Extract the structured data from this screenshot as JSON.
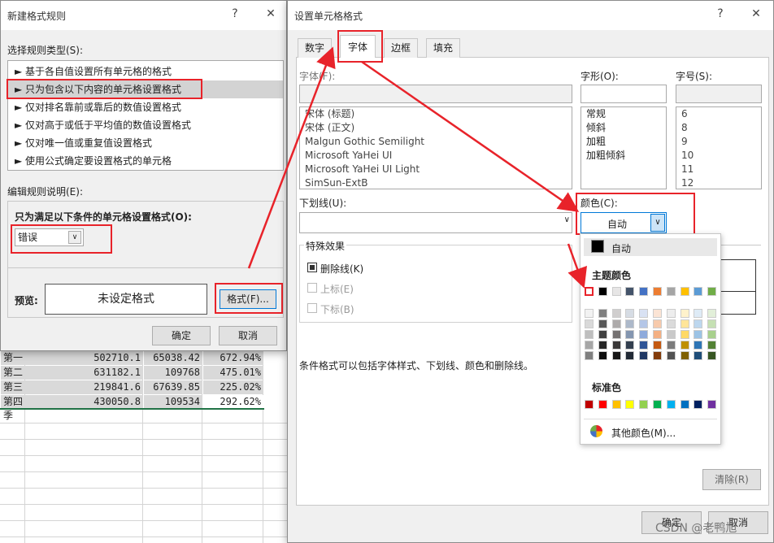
{
  "sheet": {
    "rows": [
      {
        "label": "第一季",
        "v1": "502710.1",
        "v2": "65038.42",
        "v3": "672.94%"
      },
      {
        "label": "第二季",
        "v1": "631182.1",
        "v2": "109768",
        "v3": "475.01%"
      },
      {
        "label": "第三季",
        "v1": "219841.6",
        "v2": "67639.85",
        "v3": "225.02%"
      },
      {
        "label": "第四季",
        "v1": "430050.8",
        "v2": "109534",
        "v3": "292.62%"
      }
    ]
  },
  "rule": {
    "title": "新建格式规则",
    "help": "?",
    "close": "✕",
    "type_label": "选择规则类型(S):",
    "types": [
      "► 基于各自值设置所有单元格的格式",
      "► 只为包含以下内容的单元格设置格式",
      "► 仅对排名靠前或靠后的数值设置格式",
      "► 仅对高于或低于平均值的数值设置格式",
      "► 仅对唯一值或重复值设置格式",
      "► 使用公式确定要设置格式的单元格"
    ],
    "edit_label": "编辑规则说明(E):",
    "cond_label": "只为满足以下条件的单元格设置格式(O):",
    "cond_value": "错误",
    "preview_label": "预览:",
    "preview_text": "未设定格式",
    "format_btn": "格式(F)...",
    "ok": "确定",
    "cancel": "取消"
  },
  "fmt": {
    "title": "设置单元格格式",
    "help": "?",
    "close": "✕",
    "tabs": [
      "数字",
      "字体",
      "边框",
      "填充"
    ],
    "font_label": "字体(F):",
    "fonts": [
      "宋体 (标题)",
      "宋体 (正文)",
      "Malgun Gothic Semilight",
      "Microsoft YaHei UI",
      "Microsoft YaHei UI Light",
      "SimSun-ExtB"
    ],
    "style_label": "字形(O):",
    "styles": [
      "常规",
      "倾斜",
      "加粗",
      "加粗倾斜"
    ],
    "size_label": "字号(S):",
    "sizes": [
      "6",
      "8",
      "9",
      "10",
      "11",
      "12"
    ],
    "underline_label": "下划线(U):",
    "color_label": "颜色(C):",
    "color_value": "自动",
    "effects_label": "特殊效果",
    "strike": "删除线(K)",
    "super": "上标(E)",
    "sub": "下标(B)",
    "note": "条件格式可以包括字体样式、下划线、颜色和删除线。",
    "clear": "清除(R)",
    "ok": "确定",
    "cancel": "取消",
    "watermark": "CSDN @老鸭旭"
  },
  "palette": {
    "auto": "自动",
    "theme_label": "主题颜色",
    "standard_label": "标准色",
    "more": "其他颜色(M)...",
    "theme_top": [
      "#ffffff",
      "#000000",
      "#e7e6e6",
      "#44546a",
      "#4472c4",
      "#ed7d31",
      "#a5a5a5",
      "#ffc000",
      "#5b9bd5",
      "#70ad47"
    ],
    "theme_cols": [
      [
        "#f2f2f2",
        "#d9d9d9",
        "#bfbfbf",
        "#a6a6a6",
        "#808080"
      ],
      [
        "#7f7f7f",
        "#595959",
        "#404040",
        "#262626",
        "#0d0d0d"
      ],
      [
        "#d0cece",
        "#aeabab",
        "#757171",
        "#3a3838",
        "#171616"
      ],
      [
        "#d6dce4",
        "#adb9ca",
        "#8496b0",
        "#333f4f",
        "#222a35"
      ],
      [
        "#d9e2f3",
        "#b4c6e7",
        "#8eaadb",
        "#2f5496",
        "#1f3864"
      ],
      [
        "#fbe4d5",
        "#f7caac",
        "#f4b083",
        "#c45911",
        "#833c0b"
      ],
      [
        "#ededed",
        "#dbdbdb",
        "#c9c9c9",
        "#7b7b7b",
        "#525252"
      ],
      [
        "#fff2cc",
        "#ffe599",
        "#ffd966",
        "#bf8f00",
        "#7f6000"
      ],
      [
        "#deebf6",
        "#bdd7ee",
        "#9cc3e5",
        "#2e75b5",
        "#1f4e79"
      ],
      [
        "#e2efd9",
        "#c5e0b3",
        "#a8d08d",
        "#538135",
        "#375623"
      ]
    ],
    "standard": [
      "#c00000",
      "#ff0000",
      "#ffc000",
      "#ffff00",
      "#92d050",
      "#00b050",
      "#00b0f0",
      "#0070c0",
      "#002060",
      "#7030a0"
    ],
    "accent": "#e8232a"
  }
}
